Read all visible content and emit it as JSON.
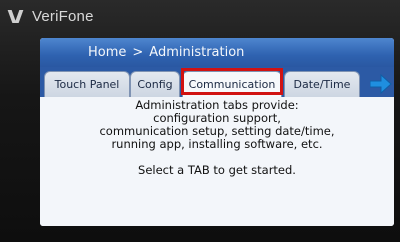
{
  "brand": {
    "name": "VeriFone"
  },
  "breadcrumb": {
    "home": "Home",
    "separator": ">",
    "current": "Administration"
  },
  "tabs": [
    {
      "label": "Touch Panel"
    },
    {
      "label": "Config"
    },
    {
      "label": "Communication",
      "selected": true
    },
    {
      "label": "Date/Time"
    }
  ],
  "next_tabs_icon": "right-arrow-icon",
  "content": {
    "lines": [
      "Administration tabs provide:",
      "configuration support,",
      "communication setup, setting date/time,",
      "running app, installing software, etc."
    ],
    "prompt": "Select a TAB to get started."
  },
  "colors": {
    "titlebar": "#2e62b0",
    "highlight": "#d01212",
    "arrow": "#1f8fe0"
  }
}
